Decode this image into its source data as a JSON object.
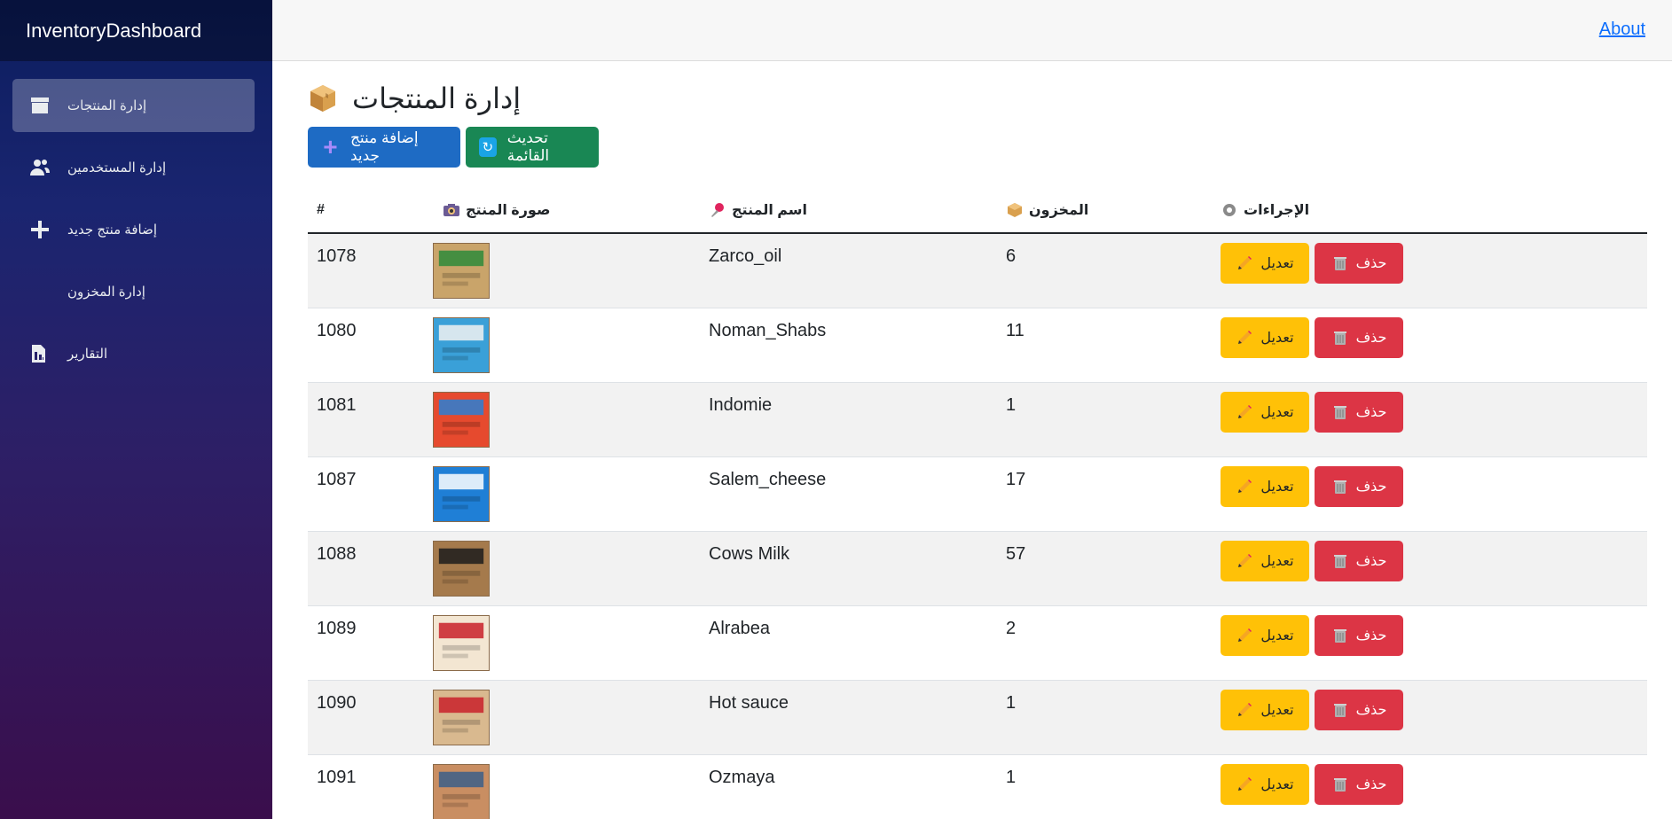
{
  "app": {
    "brand": "InventoryDashboard",
    "about_link": "About"
  },
  "sidebar": {
    "items": [
      {
        "label": "إدارة المنتجات",
        "icon": "box-icon",
        "active": true
      },
      {
        "label": "إدارة المستخدمين",
        "icon": "users-icon",
        "active": false
      },
      {
        "label": "إضافة منتج جديد",
        "icon": "plus-icon",
        "active": false
      },
      {
        "label": "إدارة المخزون",
        "icon": "",
        "active": false
      },
      {
        "label": "التقارير",
        "icon": "report-icon",
        "active": false
      }
    ]
  },
  "page": {
    "title": "إدارة المنتجات",
    "add_button": "إضافة منتج جديد",
    "refresh_button": "تحديث القائمة"
  },
  "table": {
    "headers": {
      "id": "#",
      "image": "صورة المنتج",
      "name": "اسم المنتج",
      "stock": "المخزون",
      "actions": "الإجراءات"
    },
    "edit_label": "تعديل",
    "delete_label": "حذف",
    "rows": [
      {
        "id": "1078",
        "name": "Zarco_oil",
        "stock": "6",
        "thumb_color": "#c9a46a",
        "thumb_accent": "#2e8b3a"
      },
      {
        "id": "1080",
        "name": "Noman_Shabs",
        "stock": "11",
        "thumb_color": "#3aa0d8",
        "thumb_accent": "#f2f2f2"
      },
      {
        "id": "1081",
        "name": "Indomie",
        "stock": "1",
        "thumb_color": "#e64a2e",
        "thumb_accent": "#2a7fd4"
      },
      {
        "id": "1087",
        "name": "Salem_cheese",
        "stock": "17",
        "thumb_color": "#1f7fd6",
        "thumb_accent": "#ffffff"
      },
      {
        "id": "1088",
        "name": "Cows Milk",
        "stock": "57",
        "thumb_color": "#a57a4c",
        "thumb_accent": "#1c1c1c"
      },
      {
        "id": "1089",
        "name": "Alrabea",
        "stock": "2",
        "thumb_color": "#f3e6d2",
        "thumb_accent": "#c8202a"
      },
      {
        "id": "1090",
        "name": "Hot sauce",
        "stock": "1",
        "thumb_color": "#d9b98f",
        "thumb_accent": "#c8202a"
      },
      {
        "id": "1091",
        "name": "Ozmaya",
        "stock": "1",
        "thumb_color": "#c98e62",
        "thumb_accent": "#3b5f8a"
      }
    ]
  },
  "colors": {
    "primary": "#1e6bc4",
    "success": "#198754",
    "warning": "#ffc107",
    "danger": "#dc3545"
  }
}
